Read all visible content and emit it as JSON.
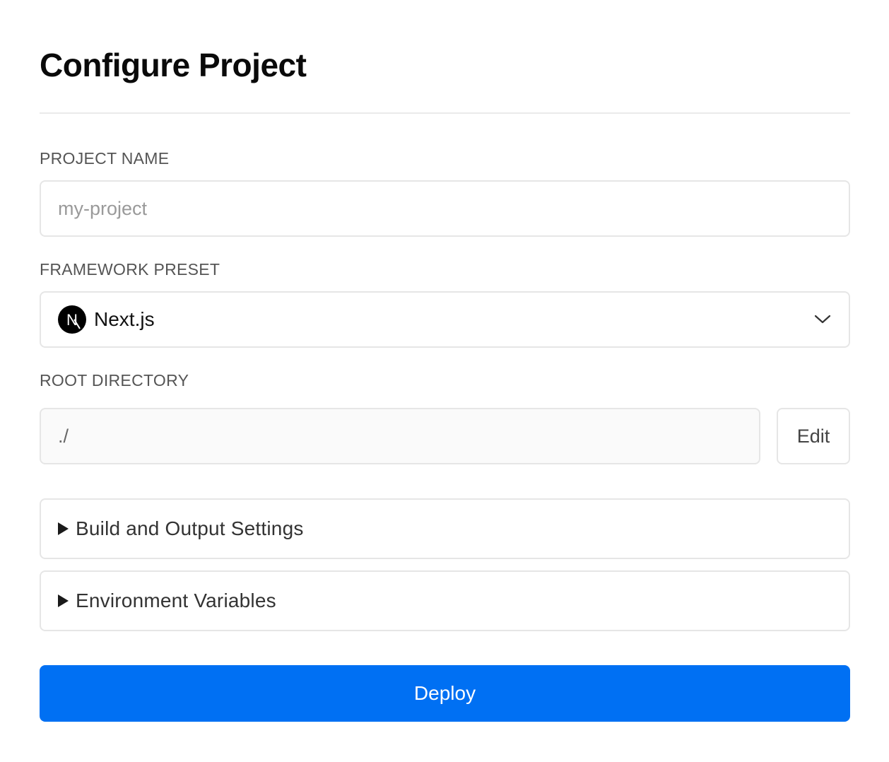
{
  "page": {
    "title": "Configure Project"
  },
  "project_name": {
    "label": "PROJECT NAME",
    "value": "",
    "placeholder": "my-project"
  },
  "framework": {
    "label": "FRAMEWORK PRESET",
    "selected": "Next.js",
    "logo_letter": "N",
    "icon": "nextjs-logo"
  },
  "root_directory": {
    "label": "ROOT DIRECTORY",
    "value": "./",
    "edit_label": "Edit"
  },
  "sections": [
    {
      "label": "Build and Output Settings"
    },
    {
      "label": "Environment Variables"
    }
  ],
  "deploy": {
    "label": "Deploy"
  },
  "colors": {
    "accent": "#0070f3",
    "border": "#e6e6e6",
    "label": "#555555"
  }
}
